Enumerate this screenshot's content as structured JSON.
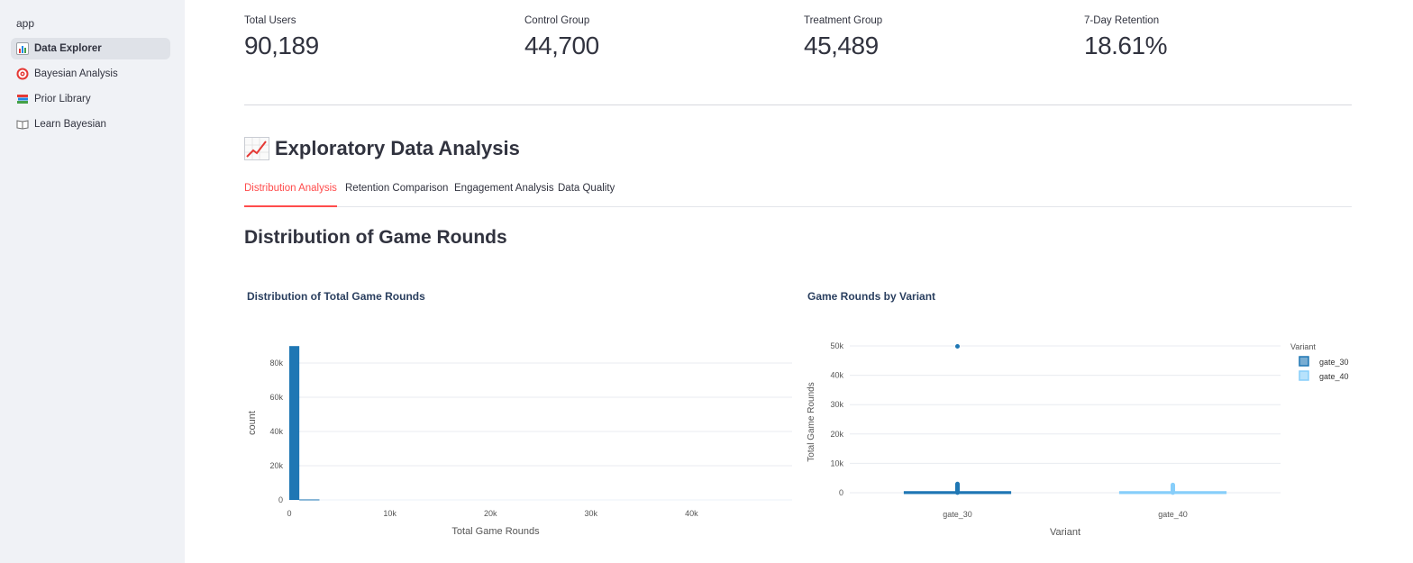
{
  "sidebar": {
    "app_title": "app",
    "items": [
      {
        "label": "Data Explorer",
        "icon": "bar-chart-icon"
      },
      {
        "label": "Bayesian Analysis",
        "icon": "target-icon"
      },
      {
        "label": "Prior Library",
        "icon": "books-icon"
      },
      {
        "label": "Learn Bayesian",
        "icon": "open-book-icon"
      }
    ]
  },
  "metrics": [
    {
      "label": "Total Users",
      "value": "90,189"
    },
    {
      "label": "Control Group",
      "value": "44,700"
    },
    {
      "label": "Treatment Group",
      "value": "45,489"
    },
    {
      "label": "7-Day Retention",
      "value": "18.61%"
    }
  ],
  "section": {
    "title": "Exploratory Data Analysis",
    "icon": "chart-increasing-icon"
  },
  "tabs": [
    "Distribution Analysis",
    "Retention Comparison",
    "Engagement Analysis",
    "Data Quality"
  ],
  "subheader": "Distribution of Game Rounds",
  "colors": {
    "accent": "#ff4b4b",
    "gate_30": "#1f77b4",
    "gate_40": "#87cefa",
    "hist": "#1f77b4"
  },
  "chart_data": [
    {
      "type": "bar",
      "title": "Distribution of Total Game Rounds",
      "xlabel": "Total Game Rounds",
      "ylabel": "count",
      "x_ticks": [
        "0",
        "10k",
        "20k",
        "30k",
        "40k"
      ],
      "y_ticks": [
        "0",
        "20k",
        "40k",
        "60k",
        "80k"
      ],
      "xlim": [
        0,
        50000
      ],
      "ylim": [
        0,
        90000
      ],
      "bins": [
        {
          "x0": 0,
          "x1": 1000,
          "count": 89900
        },
        {
          "x0": 1000,
          "x1": 3000,
          "count": 290
        }
      ],
      "grid": true
    },
    {
      "type": "box",
      "title": "Game Rounds by Variant",
      "xlabel": "Variant",
      "ylabel": "Total Game Rounds",
      "categories": [
        "gate_30",
        "gate_40"
      ],
      "y_ticks": [
        "0",
        "10k",
        "20k",
        "30k",
        "40k",
        "50k"
      ],
      "ylim": [
        0,
        50000
      ],
      "legend_title": "Variant",
      "legend_position": "right",
      "series": [
        {
          "name": "gate_30",
          "median": 17,
          "q1": 5,
          "q3": 51,
          "outlier_max": 49854,
          "outliers_up_to": 3000
        },
        {
          "name": "gate_40",
          "median": 16,
          "q1": 5,
          "q3": 52,
          "outlier_max": 2640,
          "outliers_up_to": 2640
        }
      ],
      "grid": true
    }
  ]
}
